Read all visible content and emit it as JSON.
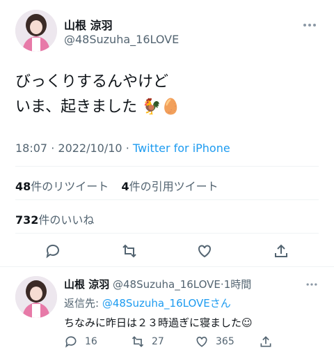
{
  "main_tweet": {
    "display_name": "山根 涼羽",
    "handle": "@48Suzuha_16LOVE",
    "more_icon": "more-dots-icon",
    "text_line1": "びっくりするんやけど",
    "text_line2": "いま、起きました",
    "emoji": "🐓🥚",
    "time": "18:07",
    "separator": "·",
    "date": "2022/10/10",
    "source": "Twitter for iPhone",
    "retweets_count": "48",
    "retweets_label": "件のリツイート",
    "quotes_count": "4",
    "quotes_label": "件の引用ツイート",
    "likes_count": "732",
    "likes_label": "件のいいね"
  },
  "actions": [
    "reply-icon",
    "retweet-icon",
    "like-icon",
    "share-icon"
  ],
  "reply_tweet": {
    "display_name": "山根 涼羽",
    "handle": "@48Suzuha_16LOVE",
    "dot": "·",
    "time_ago": "1時間",
    "replying_to_label": "返信先:",
    "replying_to_handle": "@48Suzuha_16LOVEさん",
    "text": "ちなみに昨日は２３時過ぎに寝ました☺︎",
    "reply_count": "16",
    "retweet_count": "27",
    "like_count": "365"
  },
  "colors": {
    "accent": "#1d9bf0",
    "text": "#0f1419",
    "secondary": "#536471",
    "divider": "#eff3f4"
  }
}
